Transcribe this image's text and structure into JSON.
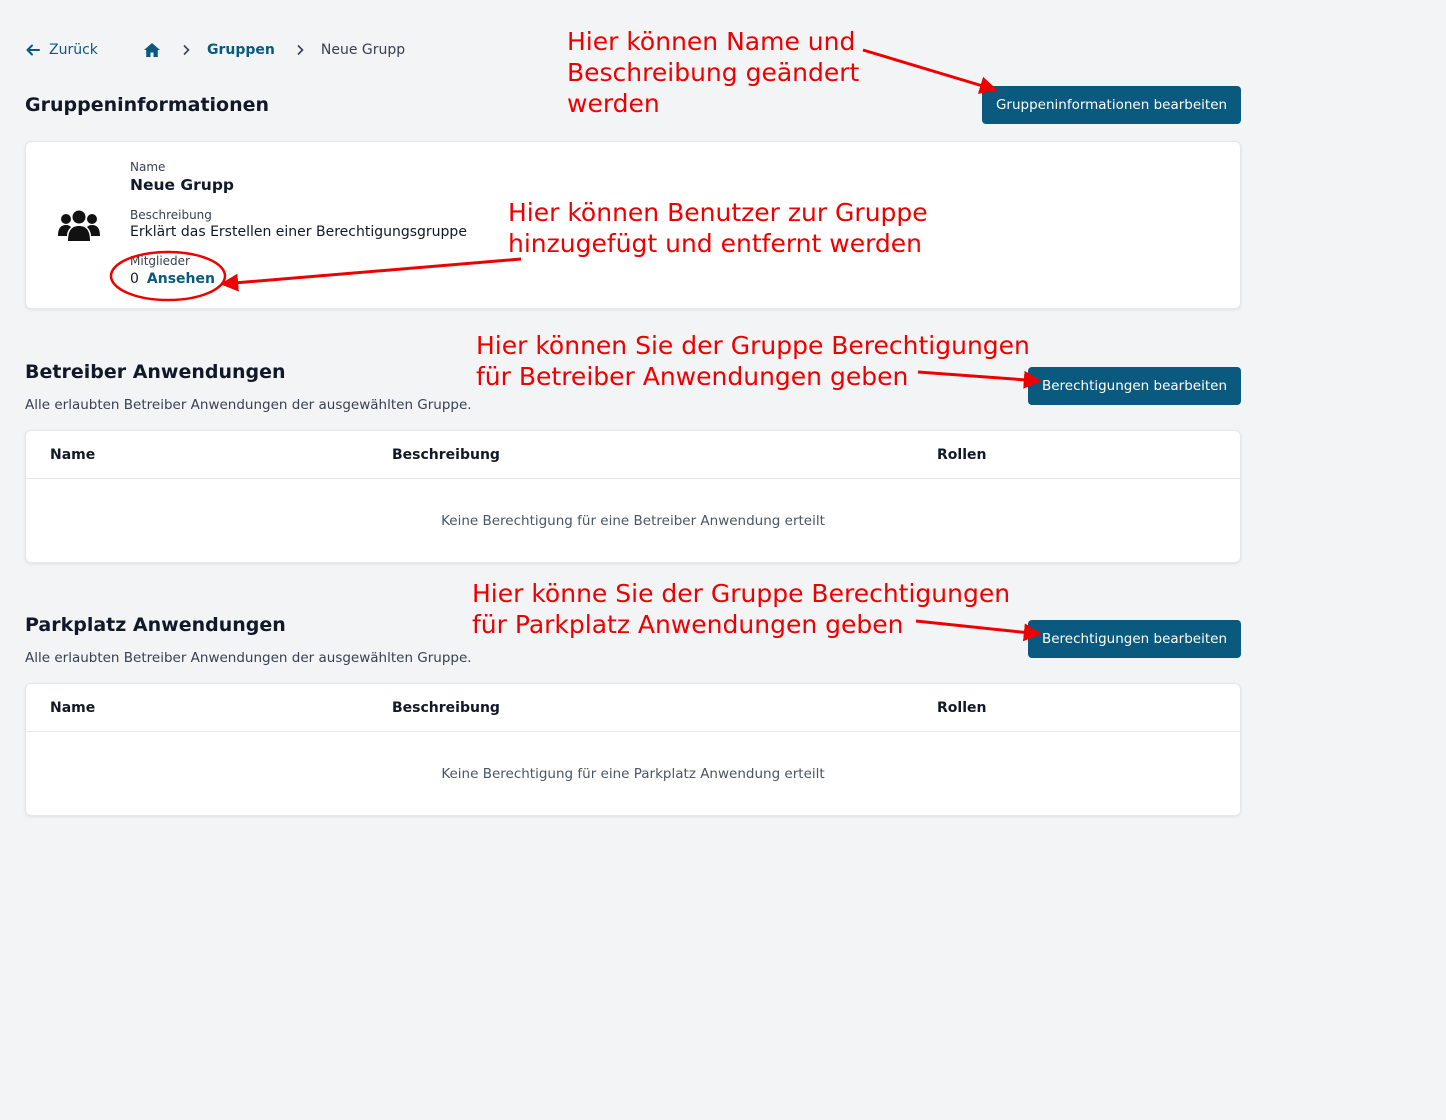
{
  "nav": {
    "back_label": "Zurück",
    "breadcrumb": [
      {
        "label": "Gruppen"
      },
      {
        "label": "Neue Grupp"
      }
    ]
  },
  "group_info": {
    "title": "Gruppeninformationen",
    "edit_button": "Gruppeninformationen bearbeiten",
    "name_label": "Name",
    "name_value": "Neue Grupp",
    "description_label": "Beschreibung",
    "description_value": "Erklärt das Erstellen einer Berechtigungsgruppe",
    "members_label": "Mitglieder",
    "members_count": "0",
    "members_link": "Ansehen"
  },
  "operator_apps": {
    "title": "Betreiber Anwendungen",
    "subtitle": "Alle erlaubten Betreiber Anwendungen der ausgewählten Gruppe.",
    "edit_button": "Berechtigungen bearbeiten",
    "columns": [
      "Name",
      "Beschreibung",
      "Rollen"
    ],
    "empty_text": "Keine Berechtigung für eine Betreiber Anwendung erteilt"
  },
  "parking_apps": {
    "title": "Parkplatz Anwendungen",
    "subtitle": "Alle erlaubten Betreiber Anwendungen der ausgewählten Gruppe.",
    "edit_button": "Berechtigungen bearbeiten",
    "columns": [
      "Name",
      "Beschreibung",
      "Rollen"
    ],
    "empty_text": "Keine Berechtigung für eine Parkplatz Anwendung erteilt"
  },
  "annotations": {
    "edit_info": [
      "Hier können Name und",
      "Beschreibung geändert",
      "werden"
    ],
    "members": [
      "Hier können Benutzer zur Gruppe",
      "hinzugefügt und entfernt werden"
    ],
    "operator": [
      "Hier können Sie der Gruppe Berechtigungen",
      "für Betreiber Anwendungen geben"
    ],
    "parking": [
      "Hier könne Sie der Gruppe Berechtigungen",
      "für Parkplatz Anwendungen geben"
    ],
    "color": "#ee0000"
  },
  "colors": {
    "accent": "#0a5a80",
    "background": "#f3f4f6"
  }
}
